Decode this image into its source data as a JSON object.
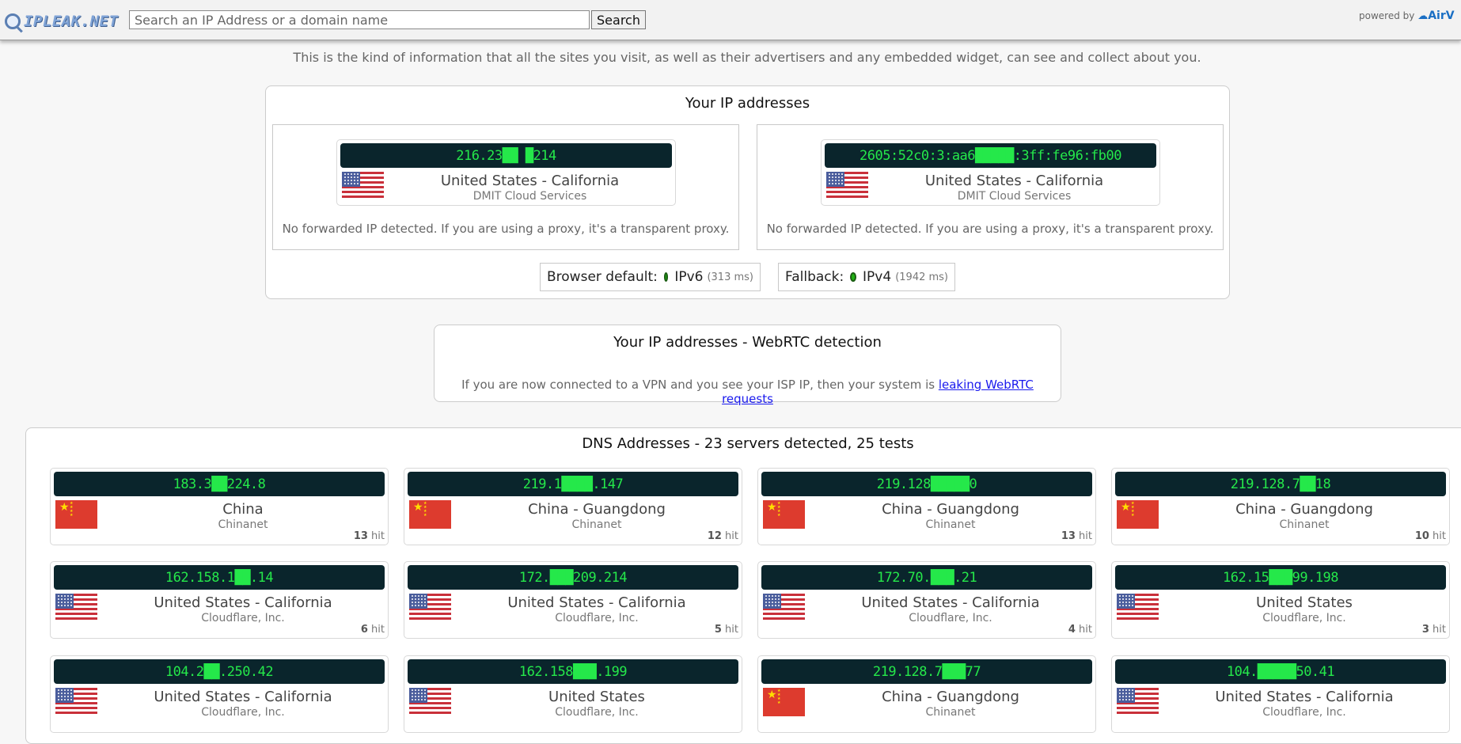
{
  "header": {
    "logo_text": "IPLEAK.NET",
    "search_placeholder": "Search an IP Address or a domain name",
    "search_button": "Search",
    "powered_by": "powered by",
    "powered_brand": "AirV"
  },
  "intro": "This is the kind of information that all the sites you visit, as well as their advertisers and any embedded widget, can see and collect about you.",
  "ip_section": {
    "title": "Your IP addresses",
    "entries": [
      {
        "ip": "216.23██ █214",
        "flag": "us",
        "location": "United States - California",
        "isp": "DMIT Cloud Services",
        "note": "No forwarded IP detected. If you are using a proxy, it's a transparent proxy."
      },
      {
        "ip": "2605:52c0:3:aa6█████:3ff:fe96:fb00",
        "flag": "us",
        "location": "United States - California",
        "isp": "DMIT Cloud Services",
        "note": "No forwarded IP detected. If you are using a proxy, it's a transparent proxy."
      }
    ],
    "browser_default": {
      "label": "Browser default:",
      "proto": "IPv6",
      "ms": "(313 ms)",
      "status_color": "#22b214"
    },
    "fallback": {
      "label": "Fallback:",
      "proto": "IPv4",
      "ms": "(1942 ms)",
      "status_color": "#22b214"
    }
  },
  "webrtc": {
    "title": "Your IP addresses - WebRTC detection",
    "text": "If you are now connected to a VPN and you see your ISP IP, then your system is",
    "link": "leaking WebRTC requests"
  },
  "dns": {
    "title": "DNS Addresses - 23 servers detected, 25 tests",
    "hit_suffix": "hit",
    "servers": [
      {
        "ip": "183.3██224.8",
        "flag": "cn",
        "location": "China",
        "isp": "Chinanet",
        "hits": "13"
      },
      {
        "ip": "219.1████.147",
        "flag": "cn",
        "location": "China - Guangdong",
        "isp": "Chinanet",
        "hits": "12"
      },
      {
        "ip": "219.128█████0",
        "flag": "cn",
        "location": "China - Guangdong",
        "isp": "Chinanet",
        "hits": "13"
      },
      {
        "ip": "219.128.7██18",
        "flag": "cn",
        "location": "China - Guangdong",
        "isp": "Chinanet",
        "hits": "10"
      },
      {
        "ip": "162.158.1██.14",
        "flag": "us",
        "location": "United States - California",
        "isp": "Cloudflare, Inc.",
        "hits": "6"
      },
      {
        "ip": "172.███209.214",
        "flag": "us",
        "location": "United States - California",
        "isp": "Cloudflare, Inc.",
        "hits": "5"
      },
      {
        "ip": "172.70.███.21",
        "flag": "us",
        "location": "United States - California",
        "isp": "Cloudflare, Inc.",
        "hits": "4"
      },
      {
        "ip": "162.15███99.198",
        "flag": "us",
        "location": "United States",
        "isp": "Cloudflare, Inc.",
        "hits": "3"
      },
      {
        "ip": "104.2██.250.42",
        "flag": "us",
        "location": "United States - California",
        "isp": "Cloudflare, Inc.",
        "hits": ""
      },
      {
        "ip": "162.158███.199",
        "flag": "us",
        "location": "United States",
        "isp": "Cloudflare, Inc.",
        "hits": ""
      },
      {
        "ip": "219.128.7███77",
        "flag": "cn",
        "location": "China - Guangdong",
        "isp": "Chinanet",
        "hits": ""
      },
      {
        "ip": "104.█████50.41",
        "flag": "us",
        "location": "United States - California",
        "isp": "Cloudflare, Inc.",
        "hits": ""
      }
    ]
  }
}
